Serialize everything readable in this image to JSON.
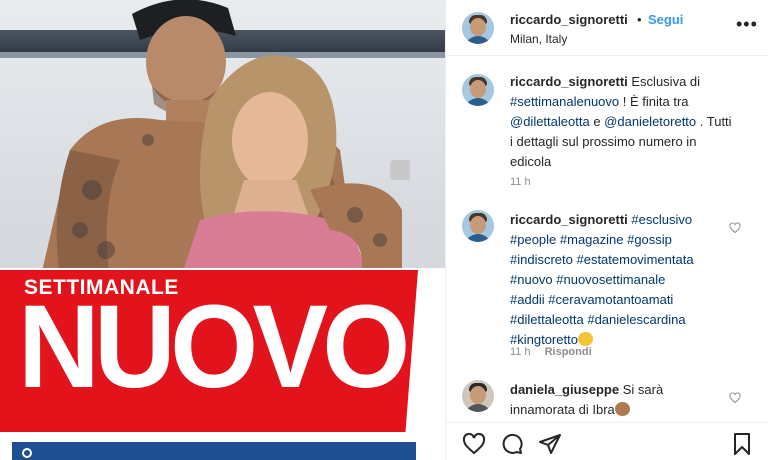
{
  "post": {
    "masthead_small": "SETTIMANALE",
    "masthead_big": "NUOVO"
  },
  "header": {
    "username": "riccardo_signoretti",
    "separator": "•",
    "follow_label": "Segui",
    "location": "Milan, Italy",
    "more_icon": "more-options-icon"
  },
  "caption": {
    "username": "riccardo_signoretti",
    "line1_text": "Esclusiva di",
    "line2_tag": "#settimanalenuovo",
    "line2_text": " ! È finita tra",
    "line3_tag1": "@dilettaleotta",
    "line3_mid": " e ",
    "line3_tag2": "@danieletoretto",
    "line3_end": " . Tutti",
    "line4": "i dettagli sul prossimo numero in",
    "line5": "edicola",
    "time": "11 h"
  },
  "comment1": {
    "username": "riccardo_signoretti",
    "tag0": "#esclusivo",
    "line2": "#people #magazine #gossip",
    "line3": "#indiscreto #estatemovimentata",
    "line4": "#nuovo #nuovosettimanale",
    "line5": "#addii #ceravamotantoamati",
    "line6": "#dilettaleotta #danielescardina",
    "line7": "#kingtoretto",
    "time": "11 h",
    "reply_label": "Rispondi"
  },
  "comment2": {
    "username": "daniela_giuseppe",
    "text1": "Si sarà",
    "text2": "innamorata di Ibra"
  },
  "colors": {
    "link_blue": "#3897f0",
    "tag_blue": "#00376b",
    "brand_red": "#e3131b"
  },
  "icons": [
    "like-heart-icon",
    "comment-icon",
    "share-icon",
    "save-bookmark-icon"
  ]
}
